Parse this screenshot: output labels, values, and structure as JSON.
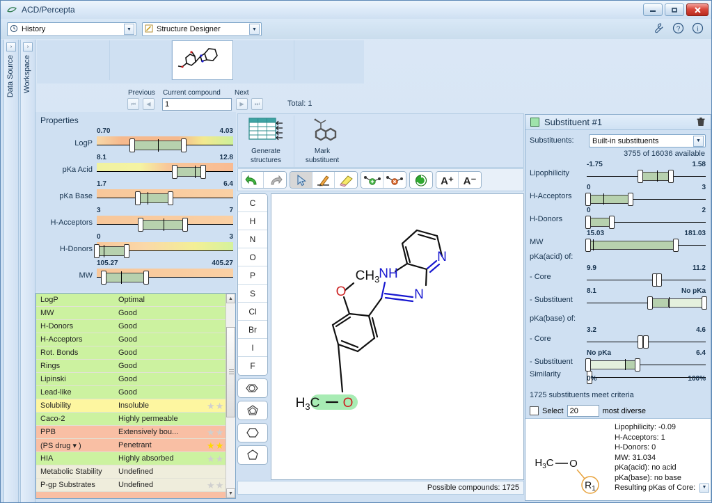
{
  "window": {
    "title": "ACD/Percepta",
    "app_icon": "leaf-icon",
    "minimize": "–",
    "maximize": "□",
    "close": "✕"
  },
  "menubar": {
    "history_combo": {
      "icon": "clock-icon",
      "value": "History"
    },
    "mode_combo": {
      "icon": "pencil-icon",
      "value": "Structure Designer"
    },
    "icons": [
      "wrench-icon",
      "help-icon",
      "info-icon"
    ]
  },
  "side_tabs": [
    {
      "label": "Data Source",
      "expand": "›"
    },
    {
      "label": "Workspace",
      "expand": "›"
    }
  ],
  "thumbnail_strip": {
    "collapse": "–",
    "cells": 5,
    "selected_index": 2
  },
  "navigation": {
    "previous_label": "Previous",
    "current_label": "Current compound",
    "next_label": "Next",
    "current_value": "1",
    "total_label": "Total: 1",
    "first_btn": "⏮",
    "prev_btn": "◀",
    "next_btn": "▶",
    "last_btn": "⏭"
  },
  "properties": {
    "title": "Properties",
    "sliders": [
      {
        "name": "LogP",
        "min": "0.70",
        "max": "4.03",
        "lo_pct": 26,
        "hi_pct": 64,
        "mid_pct": 45,
        "grad": "logp"
      },
      {
        "name": "pKa Acid",
        "min": "8.1",
        "max": "12.8",
        "lo_pct": 57,
        "hi_pct": 78,
        "mid_pct": 72,
        "grad": "acid"
      },
      {
        "name": "pKa Base",
        "min": "1.7",
        "max": "6.4",
        "lo_pct": 30,
        "hi_pct": 54,
        "mid_pct": 37,
        "grad": "flat"
      },
      {
        "name": "H-Acceptors",
        "min": "3",
        "max": "7",
        "lo_pct": 32,
        "hi_pct": 65,
        "mid_pct": 49,
        "grad": "flat"
      },
      {
        "name": "H-Donors",
        "min": "0",
        "max": "3",
        "lo_pct": 0,
        "hi_pct": 22,
        "mid_pct": 5,
        "grad": "donors"
      },
      {
        "name": "MW",
        "min": "105.27",
        "max": "405.27",
        "lo_pct": 5,
        "hi_pct": 36,
        "mid_pct": 18,
        "grad": "flat"
      }
    ]
  },
  "results_table": {
    "rows": [
      {
        "name": "LogP",
        "value": "Optimal",
        "color": "g-green",
        "stars": null
      },
      {
        "name": "MW",
        "value": "Good",
        "color": "g-green",
        "stars": null
      },
      {
        "name": "H-Donors",
        "value": "Good",
        "color": "g-green",
        "stars": null
      },
      {
        "name": "H-Acceptors",
        "value": "Good",
        "color": "g-green",
        "stars": null
      },
      {
        "name": "Rot. Bonds",
        "value": "Good",
        "color": "g-green",
        "stars": null
      },
      {
        "name": "Rings",
        "value": "Good",
        "color": "g-green",
        "stars": null
      },
      {
        "name": "Lipinski",
        "value": "Good",
        "color": "g-green",
        "stars": null
      },
      {
        "name": "Lead-like",
        "value": "Good",
        "color": "g-green",
        "stars": null
      },
      {
        "name": "Solubility",
        "value": "Insoluble",
        "color": "g-yellow",
        "stars": 0
      },
      {
        "name": "Caco-2",
        "value": "Highly permeable",
        "color": "g-green",
        "stars": null
      },
      {
        "name": "PPB",
        "value": "Extensively bou...",
        "color": "g-red",
        "stars": 0
      },
      {
        "name": "(PS drug ▾ )",
        "value": "Penetrant",
        "color": "g-red",
        "stars": 3
      },
      {
        "name": "HIA",
        "value": "Highly absorbed",
        "color": "g-green",
        "stars": 0
      },
      {
        "name": "Metabolic Stability",
        "value": "Undefined",
        "color": "g-beige",
        "stars": null
      },
      {
        "name": "P-gp Substrates",
        "value": "Undefined",
        "color": "g-beige",
        "stars": 0
      },
      {
        "name": "",
        "value": "",
        "color": "g-red",
        "stars": null
      }
    ],
    "scroll_up": "▲",
    "scroll_down": "▼"
  },
  "generate_bar": [
    {
      "label_line1": "Generate",
      "label_line2": "structures",
      "icon": "table-generate-icon"
    },
    {
      "label_line1": "Mark",
      "label_line2": "substituent",
      "icon": "naphthalene-mark-icon"
    }
  ],
  "toolbar": {
    "groups": [
      [
        {
          "name": "undo-icon"
        },
        {
          "name": "redo-icon"
        }
      ],
      [
        {
          "name": "select-arrow-icon",
          "active": true
        },
        {
          "name": "pencil-draw-icon"
        },
        {
          "name": "eraser-icon"
        }
      ],
      [
        {
          "name": "add-bond-icon"
        },
        {
          "name": "delete-bond-icon"
        }
      ],
      [
        {
          "name": "refresh-cycle-icon"
        }
      ],
      [
        {
          "name": "increase-font-icon",
          "label": "A⁺"
        },
        {
          "name": "decrease-font-icon",
          "label": "A⁻"
        }
      ]
    ]
  },
  "atom_palette": {
    "atoms": [
      "C",
      "H",
      "N",
      "O",
      "P",
      "S",
      "Cl",
      "Br",
      "I",
      "F"
    ],
    "rings": [
      "benzene-ring-icon",
      "cyclopentadiene-ring-icon",
      "cyclohexane-ring-icon",
      "cyclopentane-ring-icon"
    ]
  },
  "canvas": {
    "molecule_labels": [
      "CH3",
      "O",
      "NH",
      "N",
      "N",
      "H3C",
      "O"
    ],
    "highlighted_group": "H3C-O"
  },
  "status": {
    "possible_compounds": "Possible compounds: 1725"
  },
  "substituent_panel": {
    "header": "Substituent #1",
    "trash_icon": "trash-icon",
    "substituents_label": "Substituents:",
    "source_value": "Built-in substituents",
    "available_text": "3755 of 16036 available",
    "sliders": [
      {
        "name": "Lipophilicity",
        "min": "-1.75",
        "max": "1.58",
        "lo_pct": 44,
        "hi_pct": 72,
        "mid_pct": 59,
        "style": "solid"
      },
      {
        "name": "H-Acceptors",
        "min": "0",
        "max": "3",
        "lo_pct": 0,
        "hi_pct": 38,
        "mid_pct": 14,
        "style": "solid"
      },
      {
        "name": "H-Donors",
        "min": "0",
        "max": "2",
        "lo_pct": 0,
        "hi_pct": 22,
        "mid_pct": -1,
        "style": "solid"
      },
      {
        "name": "MW",
        "min": "15.03",
        "max": "181.03",
        "lo_pct": 0,
        "hi_pct": 76,
        "mid_pct": 5,
        "style": "solid"
      }
    ],
    "pka_acid_label": "pKa(acid) of:",
    "pka_acid_sliders": [
      {
        "name": "- Core",
        "min": "9.9",
        "max": "11.2",
        "lo_pct": 56,
        "hi_pct": 62,
        "mid_pct": 59,
        "style": "solid"
      },
      {
        "name": "- Substituent",
        "min": "8.1",
        "max": "No pKa",
        "lo_pct": 52,
        "hi_pct": 100,
        "mid_pct": 69,
        "style": "split-right"
      }
    ],
    "pka_base_label": "pKa(base) of:",
    "pka_base_sliders": [
      {
        "name": "- Core",
        "min": "3.2",
        "max": "4.6",
        "lo_pct": 44,
        "hi_pct": 51,
        "mid_pct": 48,
        "style": "solid"
      },
      {
        "name": "- Substituent",
        "min": "No pKa",
        "max": "6.4",
        "lo_pct": 0,
        "hi_pct": 44,
        "mid_pct": 32,
        "style": "split-left"
      }
    ],
    "similarity": {
      "name": "Similarity",
      "min_pct": "0%",
      "max_pct": "100%",
      "pos_pct": 0
    },
    "criteria_text": "1725 substituents meet criteria",
    "select_label": "Select",
    "diverse_value": "20",
    "most_diverse_label": "most diverse",
    "info": {
      "structure_labels": [
        "H3C",
        "O",
        "R1"
      ],
      "lines": [
        "Lipophilicity: -0.09",
        "H-Acceptors: 1",
        "H-Donors: 0",
        "MW: 31.034",
        "pKa(acid): no acid",
        "pKa(base): no base"
      ],
      "last_line": "Resulting pKas of Core:"
    }
  },
  "colors": {
    "accent_blue": "#cfe0f2",
    "green_ok": "#ccf2a0",
    "yellow_warn": "#fdf6a0",
    "red_bad": "#f9bfa4",
    "slider_green": "#b7d1ae",
    "nitrogen_blue": "#1818d0",
    "highlight_green": "#a8ecb4"
  }
}
